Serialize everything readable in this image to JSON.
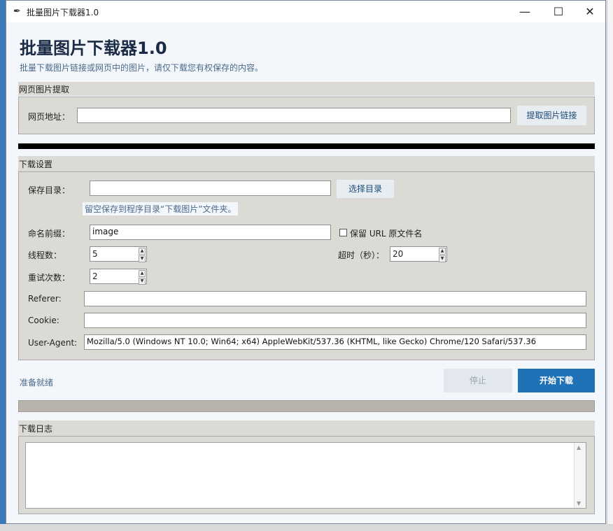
{
  "window": {
    "title": "批量图片下载器1.0",
    "minimize_icon": "minimize-icon",
    "maximize_icon": "maximize-icon",
    "close_icon": "close-icon"
  },
  "header": {
    "title": "批量图片下载器1.0",
    "subtitle": "批量下载图片链接或网页中的图片，请仅下载您有权保存的内容。"
  },
  "extract": {
    "group_label": "网页图片提取",
    "url_label": "网页地址：",
    "url_value": "",
    "extract_button": "提取图片链接"
  },
  "settings": {
    "group_label": "下载设置",
    "save_dir_label": "保存目录：",
    "save_dir_value": "",
    "choose_dir_button": "选择目录",
    "save_dir_hint": "留空保存到程序目录“下载图片”文件夹。",
    "prefix_label": "命名前缀：",
    "prefix_value": "image",
    "keep_name_label": "保留 URL 原文件名",
    "keep_name_checked": false,
    "threads_label": "线程数：",
    "threads_value": "5",
    "timeout_label": "超时（秒）：",
    "timeout_value": "20",
    "retries_label": "重试次数：",
    "retries_value": "2",
    "referer_label": "Referer:",
    "referer_value": "",
    "cookie_label": "Cookie:",
    "cookie_value": "",
    "ua_label": "User-Agent:",
    "ua_value": "Mozilla/5.0 (Windows NT 10.0; Win64; x64) AppleWebKit/537.36 (KHTML, like Gecko) Chrome/120 Safari/537.36"
  },
  "controls": {
    "status": "准备就绪",
    "stop_button": "停止",
    "start_button": "开始下载",
    "progress": 0
  },
  "log": {
    "group_label": "下载日志",
    "content": ""
  }
}
